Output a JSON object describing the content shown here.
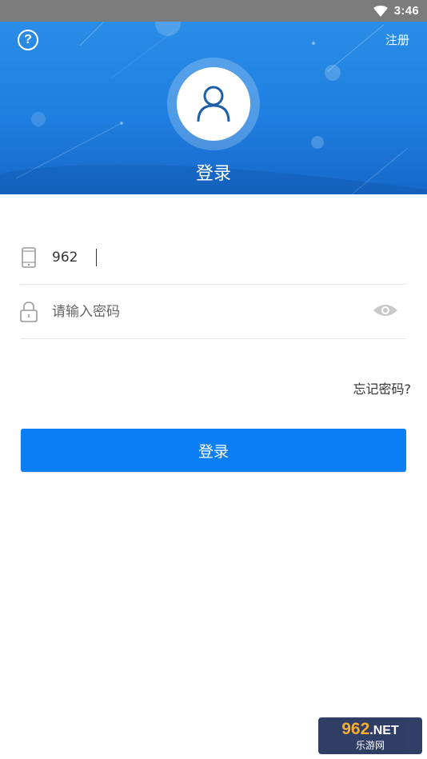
{
  "status_bar": {
    "time": "3:46"
  },
  "header": {
    "help_symbol": "?",
    "register_label": "注册",
    "title": "登录"
  },
  "form": {
    "phone": {
      "value": "962",
      "icon": "phone-icon"
    },
    "password": {
      "placeholder": "请输入密码",
      "icon": "lock-icon",
      "toggle_icon": "eye-icon"
    }
  },
  "forgot_label": "忘记密码?",
  "login_button_label": "登录",
  "watermark": {
    "top": "962",
    "suffix": ".NET",
    "bottom": "乐游网"
  },
  "colors": {
    "header_blue": "#1f7fe0",
    "button_blue": "#0a7ff5",
    "status_bar": "#7b7b7b"
  }
}
